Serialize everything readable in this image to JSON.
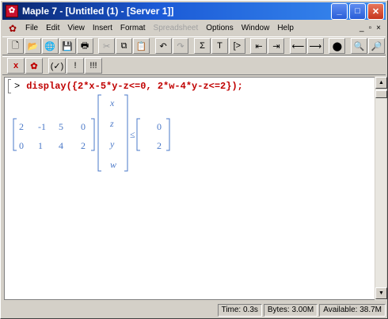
{
  "window": {
    "title": "Maple 7 - [Untitled (1) - [Server 1]]",
    "app_icon": "maple-leaf-icon",
    "minimize": "_",
    "maximize": "□",
    "close": "✕"
  },
  "menu": {
    "items": [
      "File",
      "Edit",
      "View",
      "Insert",
      "Format",
      "Spreadsheet",
      "Options",
      "Window",
      "Help"
    ],
    "disabled": [
      "Spreadsheet"
    ],
    "mdi_controls": [
      "_",
      "▫",
      "×"
    ]
  },
  "toolbar1": {
    "buttons": [
      {
        "name": "new-icon",
        "glyph": "🗋"
      },
      {
        "name": "open-icon",
        "glyph": "📂"
      },
      {
        "name": "open-url-icon",
        "glyph": "🌐"
      },
      {
        "name": "save-icon",
        "glyph": "💾"
      },
      {
        "name": "print-icon",
        "glyph": "🖶"
      },
      {
        "name": "cut-icon",
        "glyph": "✂"
      },
      {
        "name": "copy-icon",
        "glyph": "⧉"
      },
      {
        "name": "paste-icon",
        "glyph": "📋"
      },
      {
        "name": "undo-icon",
        "glyph": "↶"
      },
      {
        "name": "redo-icon",
        "glyph": "↷"
      },
      {
        "name": "sigma-icon",
        "glyph": "Σ"
      },
      {
        "name": "text-icon",
        "glyph": "T"
      },
      {
        "name": "insert-prompt-icon",
        "glyph": "[>"
      },
      {
        "name": "indent-icon",
        "glyph": "⇤"
      },
      {
        "name": "outdent-icon",
        "glyph": "⇥"
      },
      {
        "name": "back-icon",
        "glyph": "⟵"
      },
      {
        "name": "forward-icon",
        "glyph": "⟶"
      },
      {
        "name": "stop-icon",
        "glyph": "⬤"
      },
      {
        "name": "zoom-in-icon",
        "glyph": "🔍"
      },
      {
        "name": "zoom-out-icon",
        "glyph": "🔎"
      }
    ],
    "disabled": [
      "cut-icon",
      "redo-icon"
    ]
  },
  "toolbar2": {
    "buttons": [
      {
        "name": "math-mode-icon",
        "glyph": "x"
      },
      {
        "name": "maple-input-icon",
        "glyph": "✿"
      },
      {
        "name": "auto-correct-icon",
        "glyph": "(✓)"
      },
      {
        "name": "execute-icon",
        "glyph": "!"
      },
      {
        "name": "execute-all-icon",
        "glyph": "!!!"
      }
    ]
  },
  "worksheet": {
    "prompt": ">",
    "command": "display({2*x-5*y-z<=0, 2*w-4*y-z<=2});",
    "matrix_a": [
      [
        "2",
        "-1",
        "5",
        "0"
      ],
      [
        "0",
        "1",
        "4",
        "2"
      ]
    ],
    "vector_vars": [
      "x",
      "z",
      "y",
      "w"
    ],
    "relation": "≤",
    "vector_b": [
      "0",
      "2"
    ]
  },
  "status": {
    "time": "Time: 0.3s",
    "bytes": "Bytes: 3.00M",
    "available": "Available: 38.7M"
  }
}
